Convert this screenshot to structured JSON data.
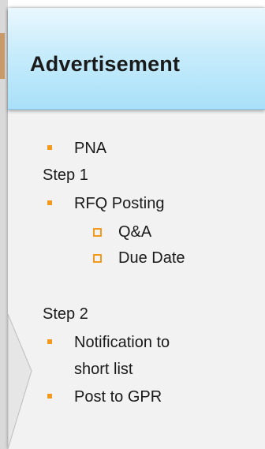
{
  "header": {
    "title": "Advertisement"
  },
  "content": {
    "item_pna": "PNA",
    "step1_label": "Step 1",
    "item_rfq_posting": "RFQ Posting",
    "sub_qa": "Q&A",
    "sub_due_date": "Due Date",
    "step2_label": "Step 2",
    "item_notification_line1": "Notification to",
    "item_notification_line2": "short list",
    "item_post_to_gpr": "Post to GPR"
  },
  "colors": {
    "header_top": "#eaf7fe",
    "header_bottom": "#a9e0f8",
    "panel_bg": "#f2f2f2",
    "bullet_orange": "#f39a1e",
    "left_accent": "#c89a6a"
  }
}
